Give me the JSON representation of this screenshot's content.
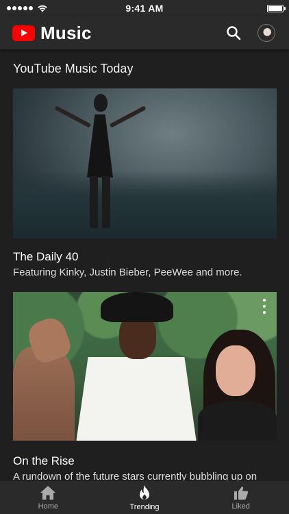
{
  "status_bar": {
    "time": "9:41 AM"
  },
  "app_bar": {
    "title": "Music",
    "logo_icon": "youtube-play-icon",
    "search_icon": "search-icon",
    "avatar_icon": "user-avatar"
  },
  "section": {
    "title": "YouTube Music Today"
  },
  "cards": [
    {
      "title": "The Daily 40",
      "subtitle": "Featuring Kinky, Justin Bieber, PeeWee and more."
    },
    {
      "title": "On the Rise",
      "subtitle": "A rundown of the future stars currently bubbling up on",
      "more_icon": "more-vert-icon"
    }
  ],
  "bottom_nav": {
    "items": [
      {
        "label": "Home",
        "icon": "home-icon",
        "active": false
      },
      {
        "label": "Trending",
        "icon": "flame-icon",
        "active": true
      },
      {
        "label": "Liked",
        "icon": "thumb-up-icon",
        "active": false
      }
    ]
  },
  "colors": {
    "brand_red": "#ff0000",
    "background": "#1f1f1f",
    "bar": "#2a2a2a",
    "inactive_nav": "#aaaaaa"
  }
}
